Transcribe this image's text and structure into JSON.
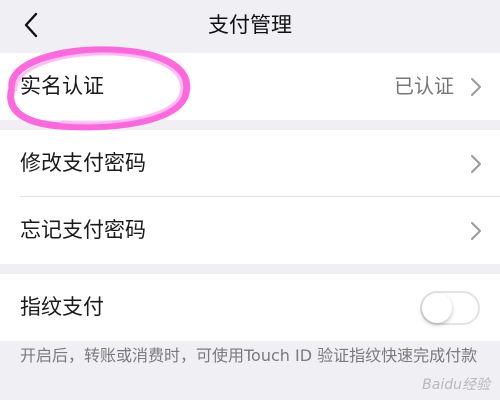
{
  "navbar": {
    "title": "支付管理",
    "back_icon": "chevron-left-icon"
  },
  "section1": {
    "items": [
      {
        "label": "实名认证",
        "value": "已认证",
        "icon": "chevron-right-icon"
      }
    ]
  },
  "section2": {
    "items": [
      {
        "label": "修改支付密码",
        "icon": "chevron-right-icon"
      },
      {
        "label": "忘记支付密码",
        "icon": "chevron-right-icon"
      }
    ]
  },
  "section3": {
    "fingerprint": {
      "label": "指纹支付",
      "enabled": false
    },
    "note": "开启后，转账或消费时，可使用Touch ID 验证指纹快速完成付款"
  },
  "annotation": {
    "color": "#ff4fd8"
  },
  "watermark": "Baidu经验"
}
